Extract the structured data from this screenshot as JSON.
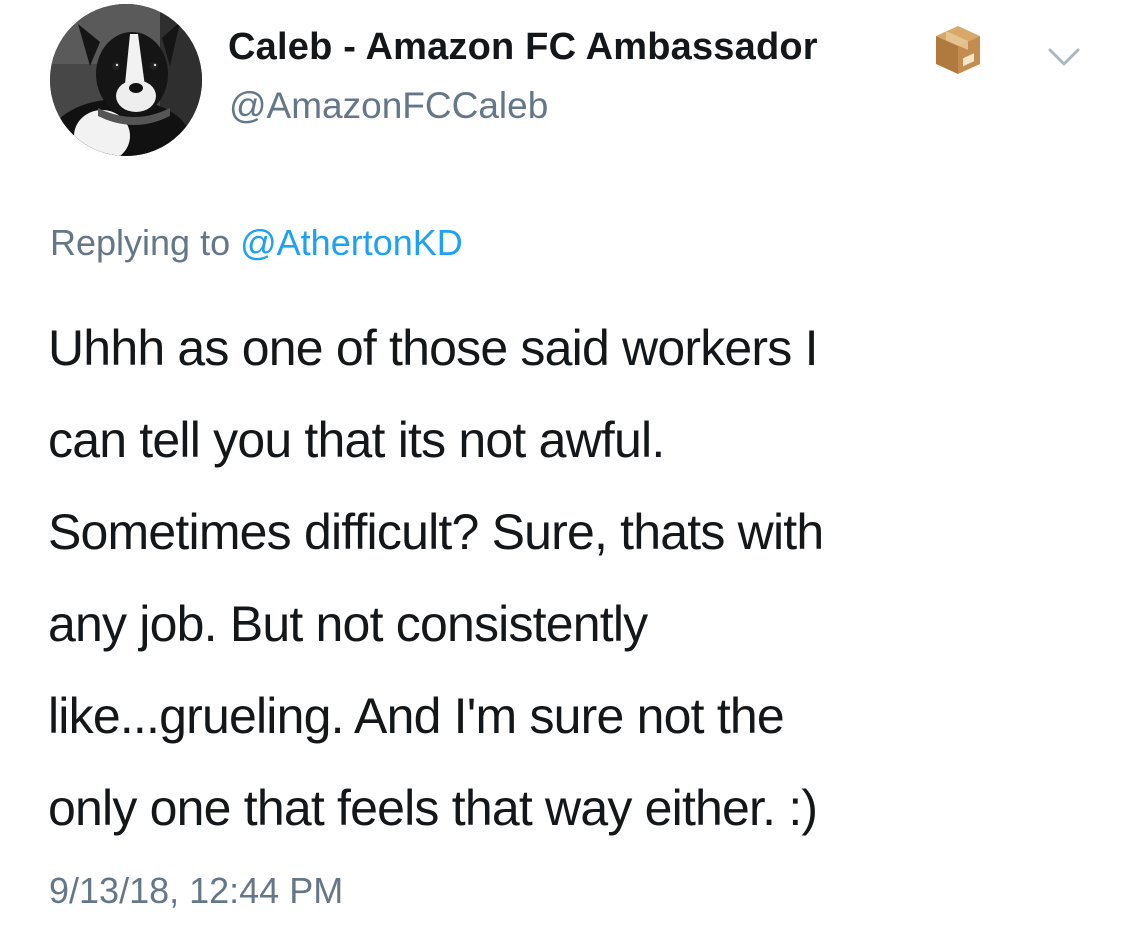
{
  "author": {
    "display_name": "Caleb - Amazon FC Ambassador",
    "handle": "@AmazonFCCaleb",
    "badge_icon": "package-icon",
    "avatar": "dog-avatar"
  },
  "menu_icon": "chevron-down-icon",
  "reply": {
    "prefix": "Replying to",
    "mention": "@AthertonKD"
  },
  "tweet": {
    "lines": [
      "Uhhh as one of those said workers I",
      "can tell you that its not awful.",
      "Sometimes difficult? Sure, thats with",
      "any job. But not consistently",
      "like...grueling. And I'm sure not the",
      "only one that feels that way either. :)"
    ]
  },
  "timestamp": "9/13/18, 12:44 PM",
  "colors": {
    "text": "#14171a",
    "secondary": "#657786",
    "link": "#1da1f2",
    "chevron": "#aab8c2"
  }
}
